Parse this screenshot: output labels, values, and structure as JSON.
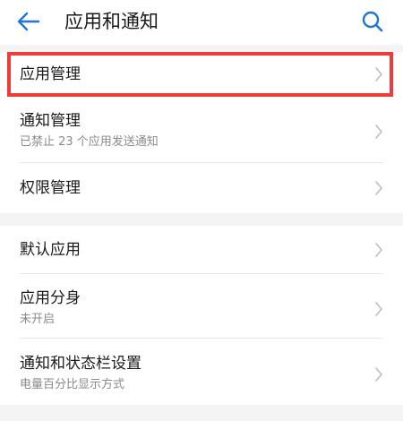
{
  "header": {
    "title": "应用和通知",
    "back_icon": "arrow-left-icon",
    "search_icon": "search-icon"
  },
  "colors": {
    "accent": "#1e77d8",
    "highlight": "#ee3b3b",
    "secondary_text": "#8a8a8a",
    "chevron": "#bdbdbd"
  },
  "groups": [
    {
      "items": [
        {
          "label": "应用管理",
          "sub": ""
        },
        {
          "label": "通知管理",
          "sub": "已禁止 23 个应用发送通知"
        },
        {
          "label": "权限管理",
          "sub": ""
        }
      ]
    },
    {
      "items": [
        {
          "label": "默认应用",
          "sub": ""
        },
        {
          "label": "应用分身",
          "sub": "未开启"
        },
        {
          "label": "通知和状态栏设置",
          "sub": "电量百分比显示方式"
        }
      ]
    }
  ]
}
